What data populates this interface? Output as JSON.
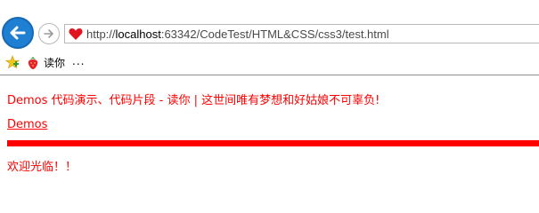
{
  "browser": {
    "address_bar": {
      "prefix": "http://",
      "host": "localhost",
      "rest": ":63342/CodeTest/HTML&CSS/css3/test.html"
    },
    "favorites": {
      "items": [
        {
          "label": "读你",
          "icon": "strawberry-icon"
        }
      ],
      "more_label": "..."
    },
    "icons": [
      "back-arrow-icon",
      "forward-arrow-icon",
      "heart-icon",
      "favorites-star-icon"
    ]
  },
  "page": {
    "heading": "Demos 代码演示、代码片段 - 读你 | 这世间唯有梦想和好姑娘不可辜负!",
    "link_label": "Demos",
    "welcome_text": "欢迎光临！！"
  },
  "colors": {
    "accent": "#ff0000",
    "back_button": "#1f7fd3"
  }
}
